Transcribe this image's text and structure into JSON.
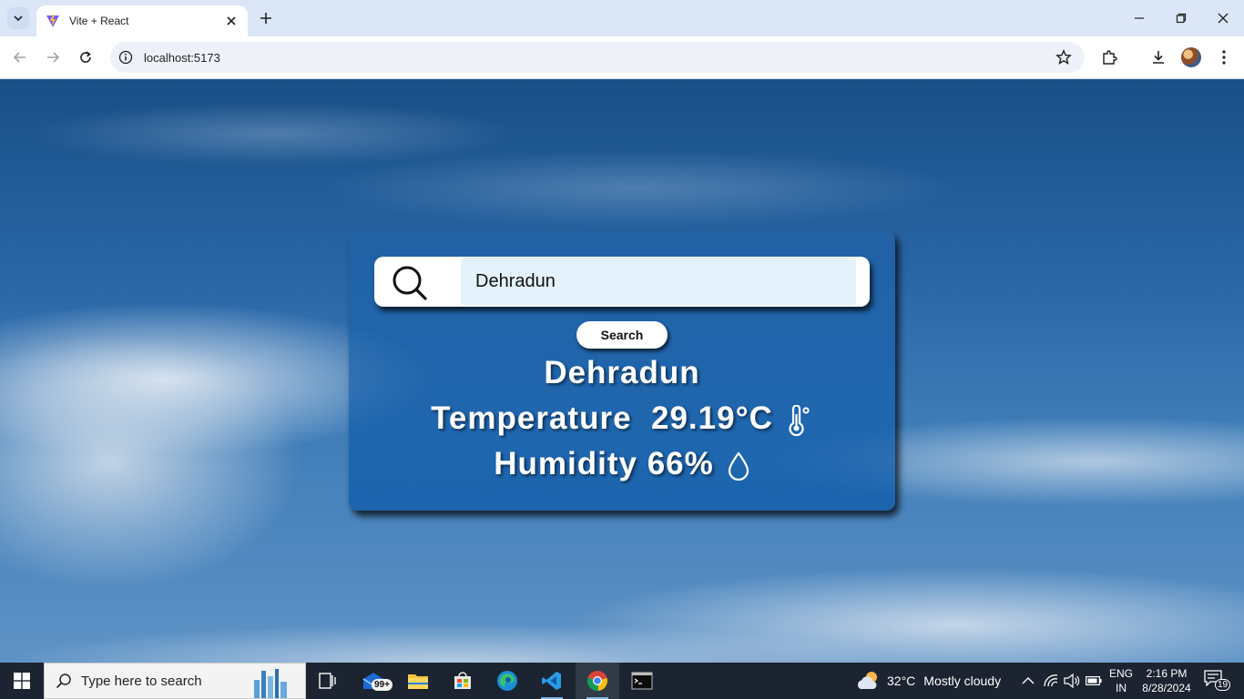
{
  "browser": {
    "tab_title": "Vite + React",
    "url": "localhost:5173"
  },
  "app": {
    "search": {
      "input_value": "Dehradun",
      "button_label": "Search"
    },
    "result": {
      "city": "Dehradun",
      "temperature_label": "Temperature",
      "temperature_value": "29.19°C",
      "humidity_label": "Humidity",
      "humidity_value": "66%"
    }
  },
  "taskbar": {
    "search_placeholder": "Type here to search",
    "mail_badge": "99+",
    "weather_temp": "32°C",
    "weather_condition": "Mostly cloudy",
    "lang_line1": "ENG",
    "lang_line2": "IN",
    "time": "2:16 PM",
    "date": "8/28/2024",
    "notification_count": "19"
  },
  "icons": {
    "tab_favicon": "vite-logo-icon",
    "search": "magnifier-icon",
    "temperature": "thermometer-icon",
    "humidity": "water-drop-icon",
    "weather": "cloud-sun-icon"
  },
  "colors": {
    "card_bg": "#0c5aaa",
    "input_bg": "#e4f2fb",
    "taskbar_bg": "#1b2430",
    "tabstrip_bg": "#dbe6f7"
  }
}
